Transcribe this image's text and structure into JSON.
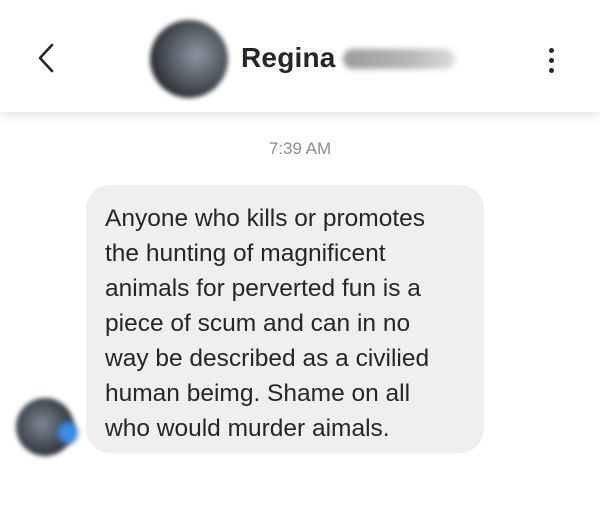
{
  "header": {
    "contact_name": "Regina",
    "back_icon": "chevron-left-icon",
    "more_icon": "more-vertical-icon"
  },
  "conversation": {
    "timestamp": "7:39 AM",
    "messages": [
      {
        "sender": "Regina",
        "text": "Anyone who kills or promotes\nthe hunting of magnificent\nanimals for perverted fun is a\npiece of scum and can in no\nway be described as a civilied\nhuman beimg. Shame on all\nwho would murder aimals."
      }
    ]
  },
  "colors": {
    "bubble_background": "#efefef",
    "timestamp_text": "#8e8e8e",
    "primary_text": "#262626"
  }
}
